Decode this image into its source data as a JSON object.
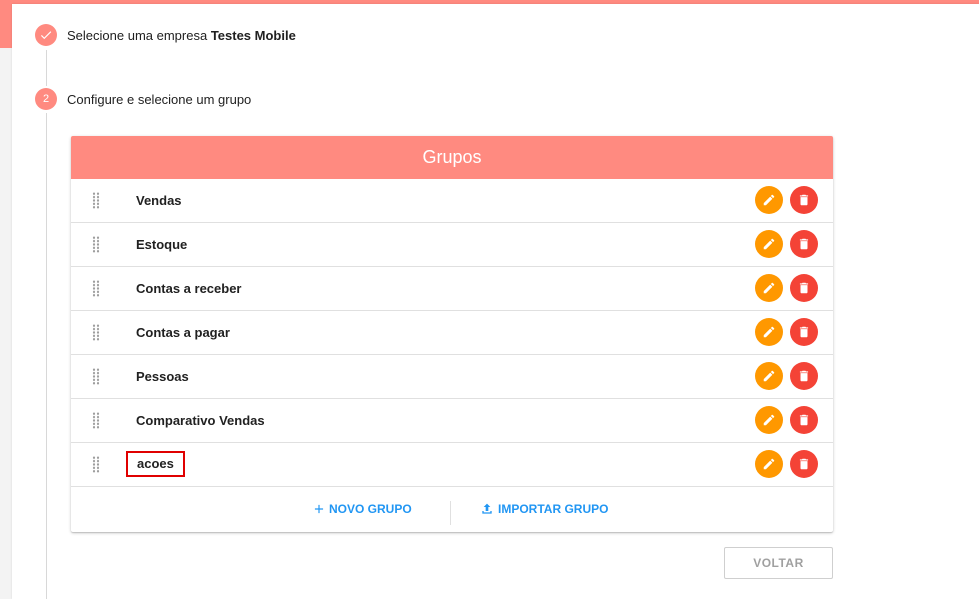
{
  "steps": [
    {
      "number": "",
      "status": "done",
      "text": "Selecione uma empresa ",
      "strong": "Testes Mobile"
    },
    {
      "number": "2",
      "status": "active",
      "text": "Configure e selecione um grupo",
      "strong": ""
    }
  ],
  "groups_card": {
    "title": "Grupos",
    "rows": [
      {
        "label": "Vendas",
        "highlighted": false
      },
      {
        "label": "Estoque",
        "highlighted": false
      },
      {
        "label": "Contas a receber",
        "highlighted": false
      },
      {
        "label": "Contas a pagar",
        "highlighted": false
      },
      {
        "label": "Pessoas",
        "highlighted": false
      },
      {
        "label": "Comparativo Vendas",
        "highlighted": false
      },
      {
        "label": "acoes",
        "highlighted": true
      }
    ],
    "new_group_label": "NOVO GRUPO",
    "import_group_label": "IMPORTAR GRUPO"
  },
  "back_label": "VOLTAR",
  "colors": {
    "accent": "#ff8a80",
    "edit": "#ff9800",
    "delete": "#f44336",
    "link": "#2196f3",
    "highlight_box": "#e00000"
  },
  "icons": {
    "done": "check-icon",
    "drag": "drag-handle-icon",
    "edit": "pencil-icon",
    "delete": "trash-icon",
    "add": "plus-icon",
    "import": "upload-icon"
  }
}
